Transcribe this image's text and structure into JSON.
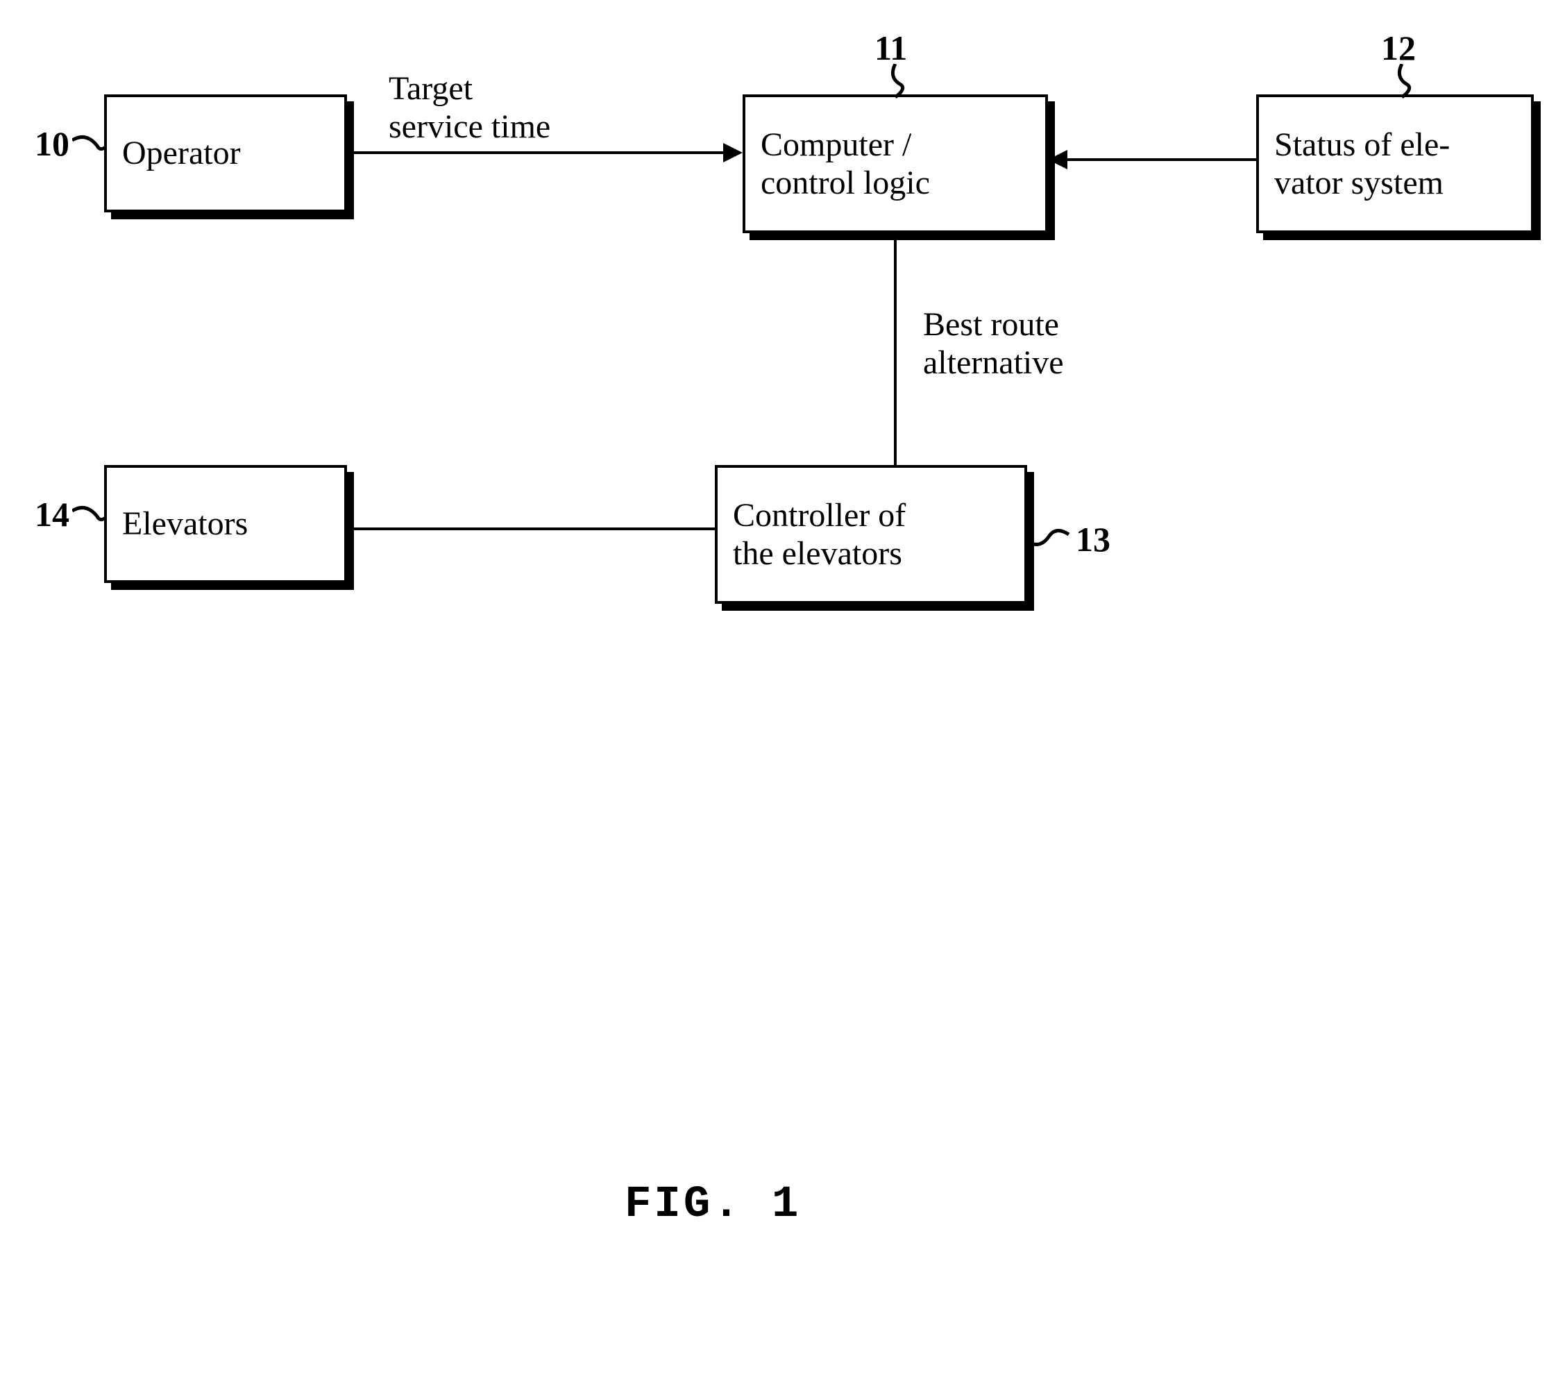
{
  "figure_label": "FIG. 1",
  "nodes": {
    "operator": {
      "ref": "10",
      "text": "Operator"
    },
    "computer": {
      "ref": "11",
      "text": "Computer /\ncontrol logic"
    },
    "status": {
      "ref": "12",
      "text": "Status of ele-\nvator system"
    },
    "controller": {
      "ref": "13",
      "text": "Controller of\nthe elevators"
    },
    "elevators": {
      "ref": "14",
      "text": "Elevators"
    }
  },
  "edges": {
    "operator_to_computer": "Target\nservice time",
    "computer_to_controller": "Best route\nalternative"
  }
}
